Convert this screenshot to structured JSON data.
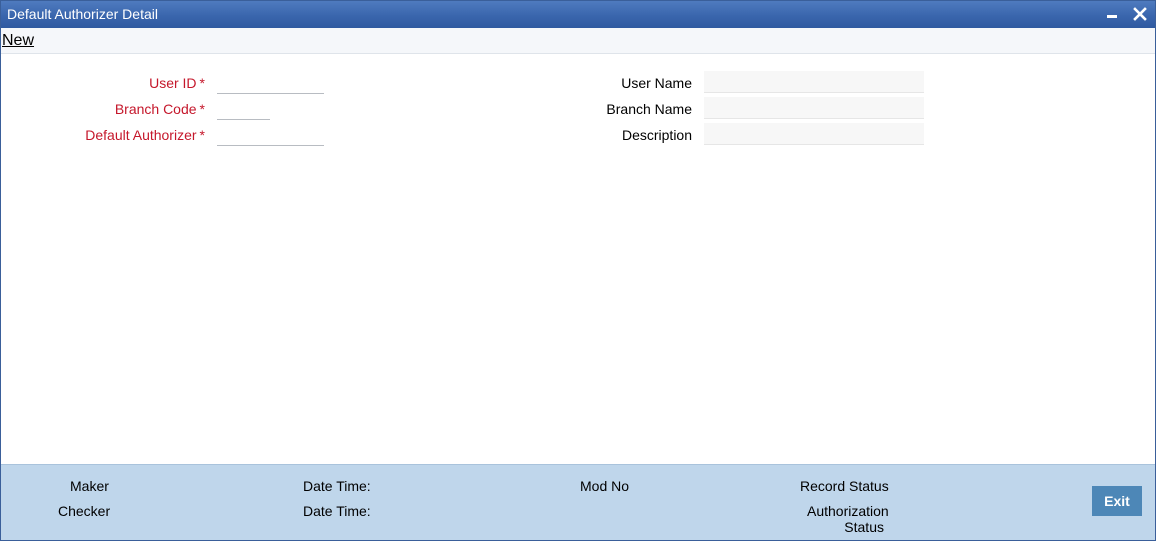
{
  "window": {
    "title": "Default Authorizer Detail"
  },
  "menu": {
    "new_label": "New"
  },
  "form": {
    "user_id": {
      "label": "User ID",
      "value": ""
    },
    "branch_code": {
      "label": "Branch Code",
      "value": ""
    },
    "default_authorizer": {
      "label": "Default Authorizer",
      "value": ""
    },
    "user_name": {
      "label": "User Name",
      "value": ""
    },
    "branch_name": {
      "label": "Branch Name",
      "value": ""
    },
    "description": {
      "label": "Description",
      "value": ""
    },
    "required_marker": "*"
  },
  "footer": {
    "maker_label": "Maker",
    "checker_label": "Checker",
    "date_time_label_1": "Date Time:",
    "date_time_label_2": "Date Time:",
    "mod_no_label": "Mod No",
    "record_status_label": "Record Status",
    "authorization_status_line1": "Authorization",
    "authorization_status_line2": "Status",
    "exit_label": "Exit"
  },
  "colors": {
    "titlebar": "#3a66ad",
    "required_label": "#c5172b",
    "footer_bg": "#bfd6eb",
    "exit_button": "#4d87b7"
  },
  "icons": {
    "minimize": "minimize-icon",
    "close": "close-icon"
  }
}
